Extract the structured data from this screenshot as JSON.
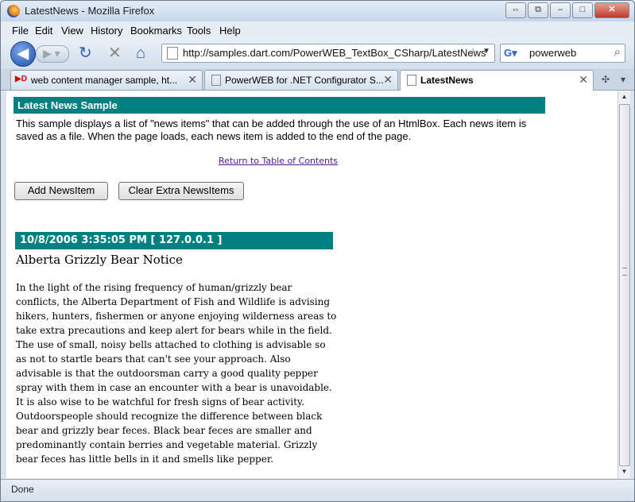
{
  "window": {
    "title": "LatestNews - Mozilla Firefox",
    "controls": [
      "⇔",
      "⧉",
      "–",
      "□",
      "✕"
    ]
  },
  "menu": [
    "File",
    "Edit",
    "View",
    "History",
    "Bookmarks",
    "Tools",
    "Help"
  ],
  "nav": {
    "url": "http://samples.dart.com/PowerWEB_TextBox_CSharp/LatestNews",
    "search_value": "powerweb"
  },
  "tabs": [
    {
      "label": "web content manager sample, ht...",
      "icon": "dart-icon"
    },
    {
      "label": "PowerWEB for .NET Configurator S...",
      "icon": "page-icon"
    },
    {
      "label": "LatestNews",
      "icon": "page-icon"
    }
  ],
  "page": {
    "banner": "Latest News Sample",
    "intro": "This sample displays a list of \"news items\" that can be added through the use of an HtmlBox. Each news item is saved as a file. When the page loads, each news item is added to the end of the page.",
    "toc_link": "Return to Table of Contents",
    "add_button": "Add NewsItem",
    "clear_button": "Clear Extra NewsItems",
    "news": {
      "header": "10/8/2006 3:35:05 PM [ 127.0.0.1 ]",
      "title": "Alberta Grizzly Bear Notice",
      "body": "In the light of the rising frequency of human/grizzly bear conflicts, the Alberta Department of Fish and Wildlife is advising hikers, hunters, fishermen or anyone enjoying wilderness areas to take extra precautions and keep alert for bears while in the field. The use of small, noisy bells attached to clothing is advisable so as not to startle bears that can't see your approach. Also advisable is that the outdoorsman carry a good quality pepper spray with them in case an encounter with a bear is unavoidable. It is also wise to be watchful for fresh signs of bear activity. Outdoorspeople should recognize the difference between black bear and grizzly bear feces. Black bear feces are smaller and predominantly contain berries and vegetable material. Grizzly bear feces has little bells in it and smells like pepper."
    }
  },
  "status": "Done",
  "colors": {
    "banner": "#008080"
  }
}
